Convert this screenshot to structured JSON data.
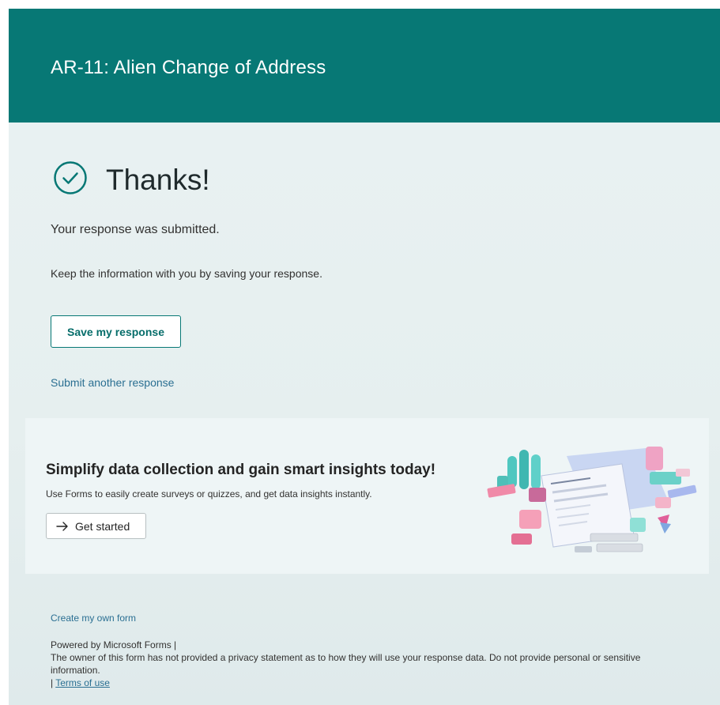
{
  "header": {
    "title": "AR-11: Alien Change of Address"
  },
  "confirmation": {
    "heading": "Thanks!",
    "submitted_text": "Your response was submitted.",
    "keep_text": "Keep the information with you by saving your response.",
    "save_button_label": "Save my response",
    "another_link": "Submit another response"
  },
  "promo": {
    "title": "Simplify data collection and gain smart insights today!",
    "description": "Use Forms to easily create surveys or quizzes, and get data insights instantly.",
    "button_label": "Get started",
    "button_icon": "arrow-right-icon"
  },
  "footer": {
    "create_link": "Create my own form",
    "powered_by": "Powered by Microsoft Forms |",
    "privacy_notice": "The owner of this form has not provided a privacy statement as to how they will use your response data. Do not provide personal or sensitive information.",
    "terms_prefix": "| ",
    "terms_link": "Terms of use"
  },
  "colors": {
    "header": "#077875",
    "page_background": "#e9f2f3",
    "link": "#2a6f92",
    "promo_background": "#eef5f6"
  },
  "icons": {
    "confirmation": "check-circle-icon"
  }
}
